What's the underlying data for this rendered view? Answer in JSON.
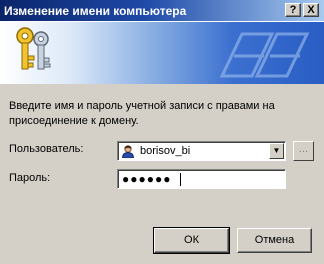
{
  "window": {
    "title": "Изменение имени компьютера",
    "help_label": "?",
    "close_label": "X"
  },
  "banner": {
    "icon": "keys-icon"
  },
  "instruction": "Введите имя и пароль учетной записи с правами на присоединение к домену.",
  "user": {
    "label": "Пользователь:",
    "value": "borisov_bi",
    "icon": "user-icon",
    "browse_label": "..."
  },
  "password": {
    "label": "Пароль:",
    "masked_value": "●●●●●●"
  },
  "buttons": {
    "ok": "ОК",
    "cancel": "Отмена"
  }
}
